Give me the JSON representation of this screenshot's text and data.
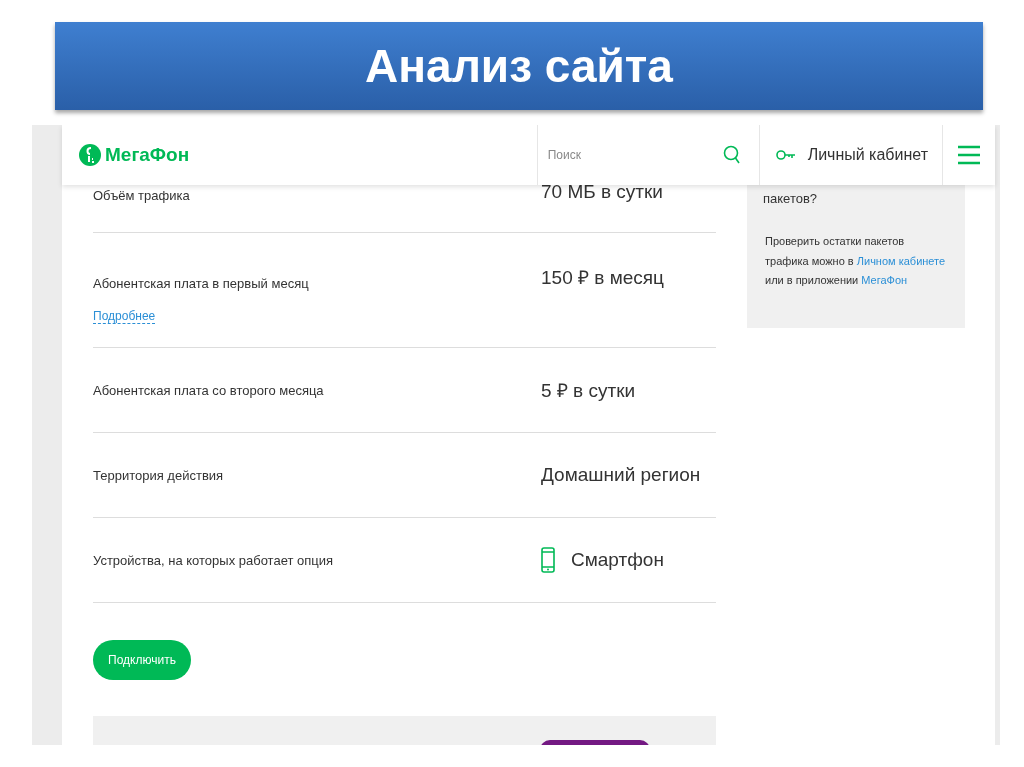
{
  "slide": {
    "title": "Анализ сайта"
  },
  "header": {
    "logo": "МегаФон",
    "search": {
      "placeholder": "Поиск"
    },
    "account_link": "Личный кабинет"
  },
  "rows": [
    {
      "kind": "text",
      "label": "Объём трафика",
      "value": "70 МБ в сутки"
    },
    {
      "kind": "text",
      "label": "Абонентская плата в первый месяц",
      "value": "150 ₽ в месяц",
      "link": "Подробнее"
    },
    {
      "kind": "text",
      "label": "Абонентская плата со второго месяца",
      "value": "5 ₽ в сутки"
    },
    {
      "kind": "text",
      "label": "Территория действия",
      "value": "Домашний регион"
    },
    {
      "kind": "device",
      "label": "Устройства, на которых работает опция",
      "value": "Смартфон"
    }
  ],
  "connect_button": "Подключить",
  "sidebar": {
    "question": "пакетов?",
    "text": [
      {
        "text": "Проверить остатки пакетов трафика можно в ",
        "link": false
      },
      {
        "text": "Личном кабинете",
        "link": true
      },
      {
        "text": " или в приложении ",
        "link": false
      },
      {
        "text": "МегаФон",
        "link": true
      }
    ]
  }
}
